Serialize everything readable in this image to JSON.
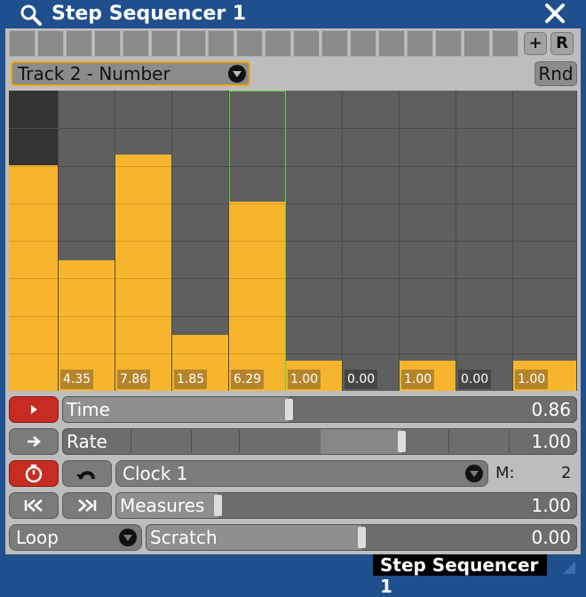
{
  "window": {
    "title": "Step Sequencer 1"
  },
  "topbar": {
    "plus_label": "+",
    "r_label": "R",
    "cell_count": 18
  },
  "track": {
    "selected": "Track 2 - Number",
    "rnd_label": "Rnd"
  },
  "steps": [
    {
      "value": 0.75,
      "label": ""
    },
    {
      "value": 0.435,
      "label": "4.35"
    },
    {
      "value": 0.786,
      "label": "7.86"
    },
    {
      "value": 0.185,
      "label": "1.85"
    },
    {
      "value": 0.629,
      "label": "6.29"
    },
    {
      "value": 0.1,
      "label": "1.00"
    },
    {
      "value": 0.0,
      "label": "0.00"
    },
    {
      "value": 0.1,
      "label": "1.00"
    },
    {
      "value": 0.0,
      "label": "0.00"
    },
    {
      "value": 0.1,
      "label": "1.00"
    }
  ],
  "controls": {
    "time": {
      "label": "Time",
      "value": "0.86",
      "fraction": 0.44
    },
    "rate": {
      "label": "Rate",
      "value": "1.00",
      "fraction": 0.66
    },
    "clock": {
      "label": "Clock 1",
      "m_label": "M:",
      "m_value": "2"
    },
    "measures": {
      "label": "Measures",
      "value": "1.00",
      "fraction": 0.22
    },
    "loop": {
      "label": "Loop"
    },
    "scratch": {
      "label": "Scratch",
      "value": "0.00",
      "fraction": 0.5
    }
  },
  "footer": {
    "label": "Step Sequencer 1"
  },
  "colors": {
    "accent": "#f6b52c",
    "title_bar": "#1f4f8c",
    "selected_outline": "#5fd63a",
    "red_button": "#c62c22"
  }
}
